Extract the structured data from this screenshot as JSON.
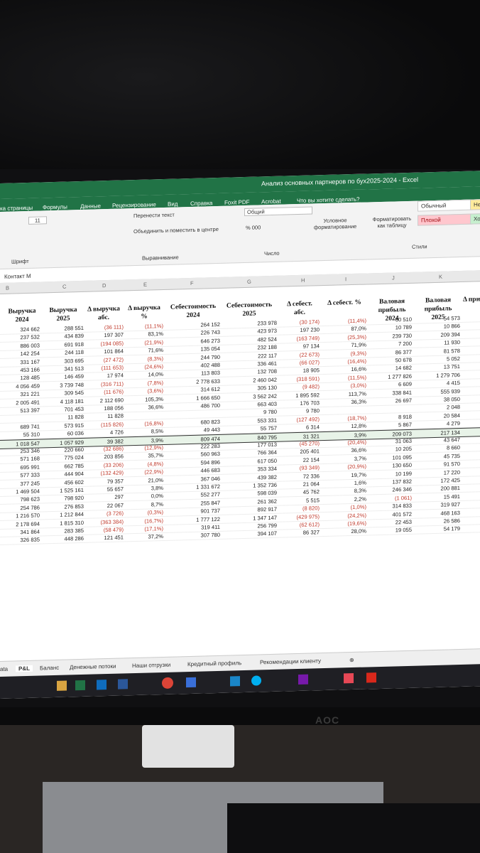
{
  "window": {
    "title": "Анализ основных партнеров по бух2025-2024  -  Excel"
  },
  "ribbon_tabs": [
    "ка страницы",
    "Формулы",
    "Данные",
    "Рецензирование",
    "Вид",
    "Справка",
    "Foxit PDF",
    "Acrobat",
    "Что вы хотите сделать?"
  ],
  "ribbon": {
    "font_size": "11",
    "wrap_text": "Перенести текст",
    "merge_center": "Объединить и поместить в центре",
    "number_format": "Общий",
    "conditional_formatting": "Условное форматирование",
    "format_as_table": "Форматировать как таблицу",
    "style_normal": "Обычный",
    "style_bad": "Плохой",
    "group_font": "Шрифт",
    "group_alignment": "Выравнивание",
    "group_number": "Число",
    "group_styles": "Стили"
  },
  "name_box": "Контакт М",
  "columns": [
    "B",
    "C",
    "D",
    "E",
    "F",
    "G",
    "H",
    "I",
    "J",
    "K"
  ],
  "headers": [
    "Выручка 2024",
    "Выручка 2025",
    "Δ выручка абс.",
    "Δ выручка %",
    "Себестоимость 2024",
    "Себестоимость 2025",
    "Δ себест. абс.",
    "Δ себест. %",
    "Валовая прибыль 2024",
    "Валовая прибыль 2025",
    "Δ при"
  ],
  "rows": [
    [
      "324 662",
      "288 551",
      "(36 111)",
      "(11,1%)",
      "264 152",
      "233 978",
      "(30 174)",
      "(11,4%)",
      "60 510",
      "54 573"
    ],
    [
      "237 532",
      "434 839",
      "197 307",
      "83,1%",
      "226 743",
      "423 973",
      "197 230",
      "87,0%",
      "10 789",
      "10 866"
    ],
    [
      "886 003",
      "691 918",
      "(194 085)",
      "(21,9%)",
      "646 273",
      "482 524",
      "(163 749)",
      "(25,3%)",
      "239 730",
      "209 394"
    ],
    [
      "142 254",
      "244 118",
      "101 864",
      "71,6%",
      "135 054",
      "232 188",
      "97 134",
      "71,9%",
      "7 200",
      "11 930"
    ],
    [
      "331 167",
      "303 695",
      "(27 472)",
      "(8,3%)",
      "244 790",
      "222 117",
      "(22 673)",
      "(9,3%)",
      "86 377",
      "81 578"
    ],
    [
      "453 166",
      "341 513",
      "(111 653)",
      "(24,6%)",
      "402 488",
      "336 461",
      "(66 027)",
      "(16,4%)",
      "50 678",
      "5 052"
    ],
    [
      "128 485",
      "146 459",
      "17 974",
      "14,0%",
      "113 803",
      "132 708",
      "18 905",
      "16,6%",
      "14 682",
      "13 751"
    ],
    [
      "4 056 459",
      "3 739 748",
      "(316 711)",
      "(7,8%)",
      "2 778 633",
      "2 460 042",
      "(318 591)",
      "(11,5%)",
      "1 277 826",
      "1 279 706"
    ],
    [
      "321 221",
      "309 545",
      "(11 676)",
      "(3,6%)",
      "314 612",
      "305 130",
      "(9 482)",
      "(3,0%)",
      "6 609",
      "4 415"
    ],
    [
      "2 005 491",
      "4 118 181",
      "2 112 690",
      "105,3%",
      "1 666 650",
      "3 562 242",
      "1 895 592",
      "113,7%",
      "338 841",
      "555 939"
    ],
    [
      "513 397",
      "701 453",
      "188 056",
      "36,6%",
      "486 700",
      "663 403",
      "176 703",
      "36,3%",
      "26 697",
      "38 050"
    ],
    [
      "",
      "11 828",
      "11 828",
      "",
      "",
      "9 780",
      "9 780",
      "",
      "",
      "2 048"
    ],
    [
      "689 741",
      "573 915",
      "(115 826)",
      "(16,8%)",
      "680 823",
      "553 331",
      "(127 492)",
      "(18,7%)",
      "8 918",
      "20 584"
    ],
    [
      "55 310",
      "60 036",
      "4 726",
      "8,5%",
      "49 443",
      "55 757",
      "6 314",
      "12,8%",
      "5 867",
      "4 279"
    ],
    [
      "1 018 547",
      "1 057 929",
      "39 382",
      "3,9%",
      "809 474",
      "840 795",
      "31 321",
      "3,9%",
      "209 073",
      "217 134"
    ],
    [
      "253 346",
      "220 660",
      "(32 686)",
      "(12,9%)",
      "222 283",
      "177 013",
      "(45 270)",
      "(20,4%)",
      "31 063",
      "43 647"
    ],
    [
      "571 168",
      "775 024",
      "203 856",
      "35,7%",
      "560 963",
      "766 364",
      "205 401",
      "36,6%",
      "10 205",
      "8 660"
    ],
    [
      "695 991",
      "662 785",
      "(33 206)",
      "(4,8%)",
      "594 896",
      "617 050",
      "22 154",
      "3,7%",
      "101 095",
      "45 735"
    ],
    [
      "577 333",
      "444 904",
      "(132 429)",
      "(22,9%)",
      "446 683",
      "353 334",
      "(93 349)",
      "(20,9%)",
      "130 650",
      "91 570"
    ],
    [
      "377 245",
      "456 602",
      "79 357",
      "21,0%",
      "367 046",
      "439 382",
      "72 336",
      "19,7%",
      "10 199",
      "17 220"
    ],
    [
      "1 469 504",
      "1 525 161",
      "55 657",
      "3,8%",
      "1 331 672",
      "1 352 736",
      "21 064",
      "1,6%",
      "137 832",
      "172 425"
    ],
    [
      "798 623",
      "798 920",
      "297",
      "0,0%",
      "552 277",
      "598 039",
      "45 762",
      "8,3%",
      "246 346",
      "200 881"
    ],
    [
      "254 786",
      "276 853",
      "22 067",
      "8,7%",
      "255 847",
      "261 362",
      "5 515",
      "2,2%",
      "(1 061)",
      "15 491"
    ],
    [
      "1 216 570",
      "1 212 844",
      "(3 726)",
      "(0,3%)",
      "901 737",
      "892 917",
      "(8 820)",
      "(1,0%)",
      "314 833",
      "319 927"
    ],
    [
      "2 178 694",
      "1 815 310",
      "(363 384)",
      "(16,7%)",
      "1 777 122",
      "1 347 147",
      "(429 975)",
      "(24,2%)",
      "401 572",
      "468 163"
    ],
    [
      "341 864",
      "283 385",
      "(58 479)",
      "(17,1%)",
      "319 411",
      "256 799",
      "(62 612)",
      "(19,6%)",
      "22 453",
      "26 586"
    ],
    [
      "326 835",
      "448 286",
      "121 451",
      "37,2%",
      "307 780",
      "394 107",
      "86 327",
      "28,0%",
      "19 055",
      "54 179"
    ]
  ],
  "sheet_tabs": [
    "ata",
    "P&L",
    "Баланс",
    "Денежные потоки",
    "Наши отгрузки",
    "Кредитный профиль",
    "Рекомендации клиенту"
  ],
  "monitor_brand": "AOC"
}
